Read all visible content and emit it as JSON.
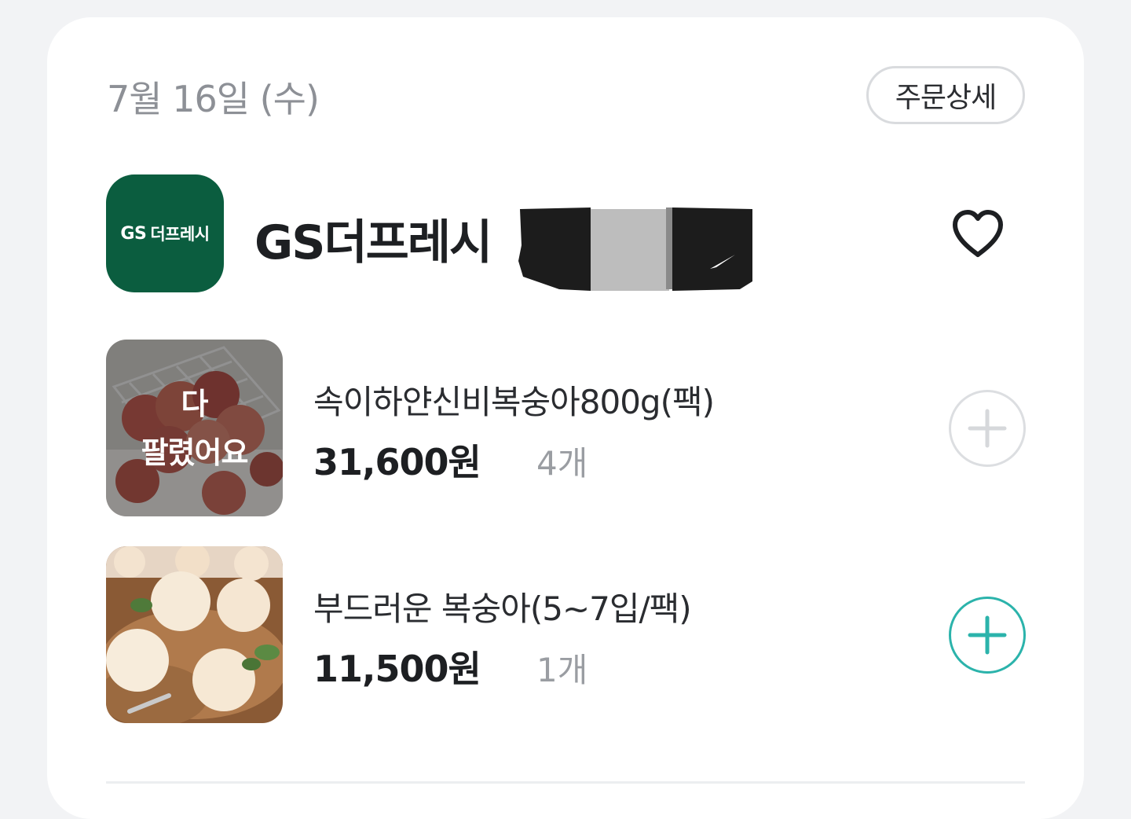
{
  "order": {
    "date": "7월 16일 (수)",
    "detail_button": "주문상세"
  },
  "store": {
    "logo_gs": "GS",
    "logo_text": "더프레시",
    "name": "GS더프레시",
    "favorite_icon": "heart-outline-icon"
  },
  "products": [
    {
      "name": "속이하얀신비복숭아800g(팩)",
      "price": "31,600원",
      "quantity": "4개",
      "soldout_line1": "다",
      "soldout_line2": "팔렸어요",
      "add_icon": "plus-icon",
      "add_state": "disabled"
    },
    {
      "name": "부드러운 복숭아(5~7입/팩)",
      "price": "11,500원",
      "quantity": "1개",
      "add_icon": "plus-icon",
      "add_state": "active"
    }
  ],
  "colors": {
    "logo_bg": "#0b5d3f",
    "accent": "#2bb3ab",
    "muted": "#8d9096"
  }
}
